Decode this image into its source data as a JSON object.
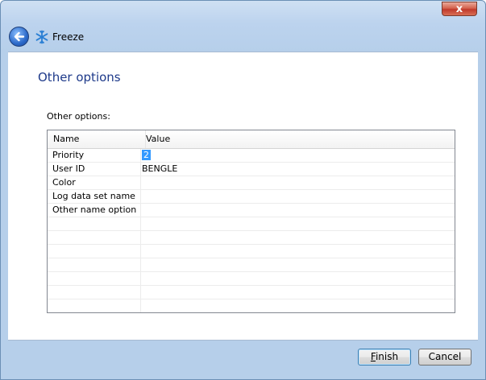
{
  "window": {
    "title": "Freeze",
    "close_glyph": "x"
  },
  "page": {
    "heading": "Other options",
    "section_label": "Other options:"
  },
  "grid": {
    "columns": [
      "Name",
      "Value"
    ],
    "rows": [
      {
        "name": "Priority",
        "value": "2",
        "selected": true
      },
      {
        "name": "User ID",
        "value": "BENGLE",
        "selected": false
      },
      {
        "name": "Color",
        "value": "",
        "selected": false
      },
      {
        "name": "Log data set name",
        "value": "",
        "selected": false
      },
      {
        "name": "Other name option",
        "value": "",
        "selected": false
      }
    ],
    "empty_row_count": 7
  },
  "buttons": {
    "finish_mnemonic": "F",
    "finish_rest": "inish",
    "cancel": "Cancel"
  },
  "icons": {
    "back": "back-arrow-icon",
    "app": "snowflake-icon",
    "close": "close-icon"
  },
  "colors": {
    "heading": "#1e3a8a",
    "selection": "#3399ff",
    "chrome": "#b6cfea"
  }
}
